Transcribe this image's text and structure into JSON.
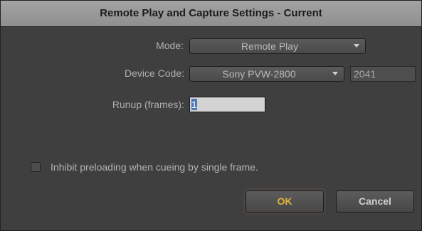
{
  "dialog": {
    "title": "Remote Play and Capture Settings - Current",
    "mode": {
      "label": "Mode:",
      "value": "Remote Play"
    },
    "device": {
      "label": "Device Code:",
      "value": "Sony PVW-2800",
      "code": "2041"
    },
    "runup": {
      "label": "Runup (frames):",
      "value": "1"
    },
    "inhibit": {
      "label": "Inhibit preloading when cueing by single frame.",
      "checked": false
    },
    "buttons": {
      "ok": "OK",
      "cancel": "Cancel"
    }
  },
  "colors": {
    "ok_text": "#e0b43a",
    "title_bg": "#9a9a9a",
    "panel_bg": "#3f3f3f"
  },
  "icons": [
    "chevron-down-icon",
    "checkbox-icon"
  ]
}
